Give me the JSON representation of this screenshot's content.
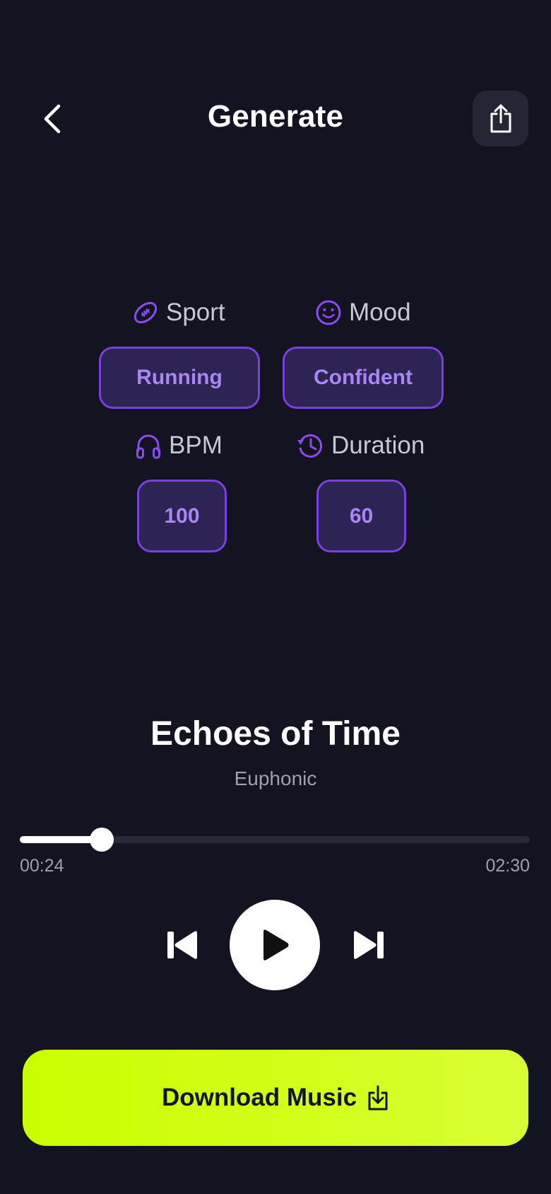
{
  "header": {
    "title": "Generate",
    "back_icon": "chevron-left-icon",
    "share_icon": "share-icon"
  },
  "options": {
    "sport": {
      "label": "Sport",
      "value": "Running",
      "icon": "football-icon"
    },
    "mood": {
      "label": "Mood",
      "value": "Confident",
      "icon": "smile-icon"
    },
    "bpm": {
      "label": "BPM",
      "value": "100",
      "icon": "headphones-icon"
    },
    "duration": {
      "label": "Duration",
      "value": "60",
      "icon": "history-icon"
    }
  },
  "track": {
    "title": "Echoes of Time",
    "artist": "Euphonic",
    "elapsed": "00:24",
    "total": "02:30",
    "progress": 0.16
  },
  "controls": {
    "previous_icon": "skip-back-icon",
    "play_icon": "play-icon",
    "next_icon": "skip-forward-icon"
  },
  "download": {
    "label": "Download Music",
    "icon": "download-icon"
  },
  "colors": {
    "background": "#141322",
    "accent": "#7b3fe0",
    "chip_text": "#a985f5",
    "chip_fill": "#2d2453",
    "cta": "#c8ff00"
  }
}
